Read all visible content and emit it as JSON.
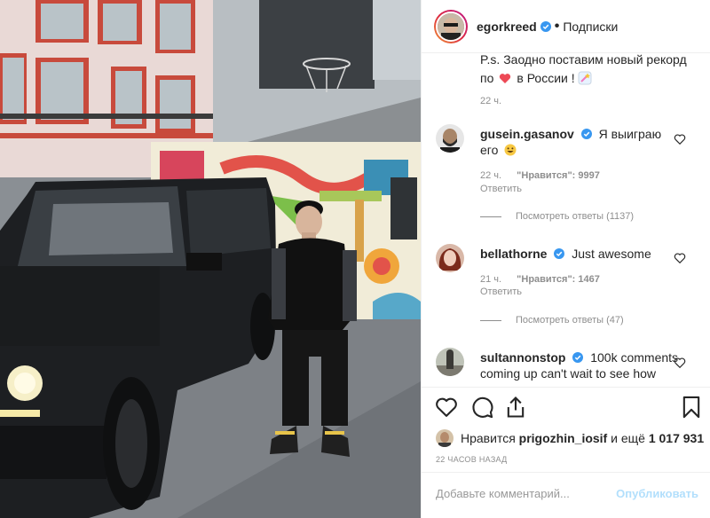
{
  "post": {
    "username": "egorkreed",
    "follow_label": "Подписки",
    "dot": "•",
    "caption_tail_1": "P.s. Заодно поставим новый рекорд",
    "caption_tail_2": "по",
    "caption_tail_3": "в России !",
    "caption_time": "22 ч."
  },
  "comments": [
    {
      "user": "gusein.gasanov",
      "text_1": "Я выиграю",
      "text_2": "его",
      "time": "22 ч.",
      "likes": "\"Нравится\": 9997",
      "reply": "Ответить",
      "view_replies": "Посмотреть ответы (1137)"
    },
    {
      "user": "bellathorne",
      "text_1": "Just awesome",
      "time": "21 ч.",
      "likes": "\"Нравится\": 1467",
      "reply": "Ответить",
      "view_replies": "Посмотреть ответы (47)"
    },
    {
      "user": "sultannonstop",
      "text_1": "100k comments",
      "text_2": "coming up can't wait to see how"
    }
  ],
  "actions": {
    "liked_prefix": "Нравится",
    "liked_user": "prigozhin_iosif",
    "liked_suffix": "и ещё",
    "liked_count": "1 017 931",
    "timestamp": "22 ЧАСОВ НАЗАД"
  },
  "add_comment": {
    "placeholder": "Добавьте комментарий...",
    "publish_label": "Опубликовать"
  },
  "colors": {
    "verified": "#3897f0",
    "publish_disabled": "#b2dffc",
    "muted_text": "#8e8e8e",
    "heart_emoji": "#ed4956"
  }
}
